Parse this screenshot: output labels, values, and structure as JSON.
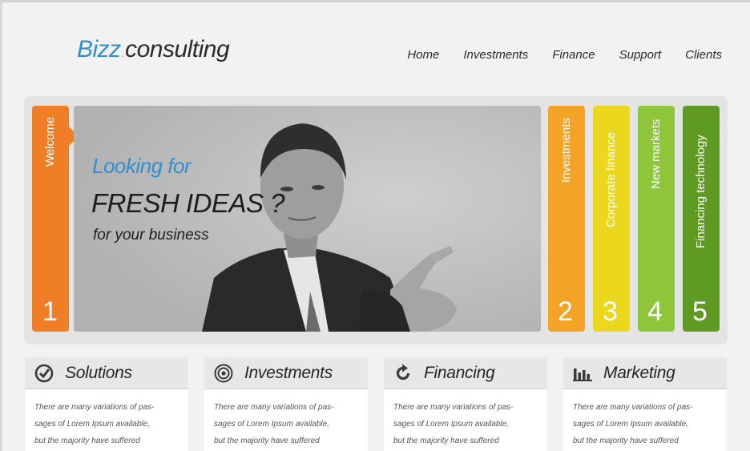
{
  "header": {
    "logo_part1": "Bizz",
    "logo_dot": ".",
    "logo_part2": "consulting",
    "nav": [
      "Home",
      "Investments",
      "Finance",
      "Support",
      "Clients"
    ]
  },
  "slider": {
    "welcome_label": "Welcome",
    "welcome_number": "1",
    "hero_line1": "Looking for",
    "hero_line2": "FRESH IDEAS ?",
    "hero_line3": "for your business",
    "tabs": [
      {
        "label": "Investments",
        "number": "2"
      },
      {
        "label": "Corporate finance",
        "number": "3"
      },
      {
        "label": "New markets",
        "number": "4"
      },
      {
        "label": "Financing technology",
        "number": "5"
      }
    ]
  },
  "cards": [
    {
      "title": "Solutions",
      "icon": "target-check-icon",
      "lines": [
        "There are many variations of pas-",
        "sages of Lorem Ipsum available,",
        "but the majority have suffered"
      ]
    },
    {
      "title": "Investments",
      "icon": "target-rings-icon",
      "lines": [
        "There are many variations of pas-",
        "sages of Lorem Ipsum available,",
        "but the majority have suffered"
      ]
    },
    {
      "title": "Financing",
      "icon": "refresh-icon",
      "lines": [
        "There are many variations of pas-",
        "sages of Lorem Ipsum available,",
        "but the majority have suffered"
      ]
    },
    {
      "title": "Marketing",
      "icon": "bar-chart-icon",
      "lines": [
        "There are many variations of pas-",
        "sages of Lorem Ipsum available,",
        "but the majority have suffered"
      ]
    }
  ],
  "colors": {
    "accent_blue": "#2f8fd0",
    "tab_orange": "#f07e27",
    "tab_amber": "#f4a327",
    "tab_yellow": "#ebd81e",
    "tab_lightgreen": "#8fc53a",
    "tab_green": "#5f9a22"
  }
}
